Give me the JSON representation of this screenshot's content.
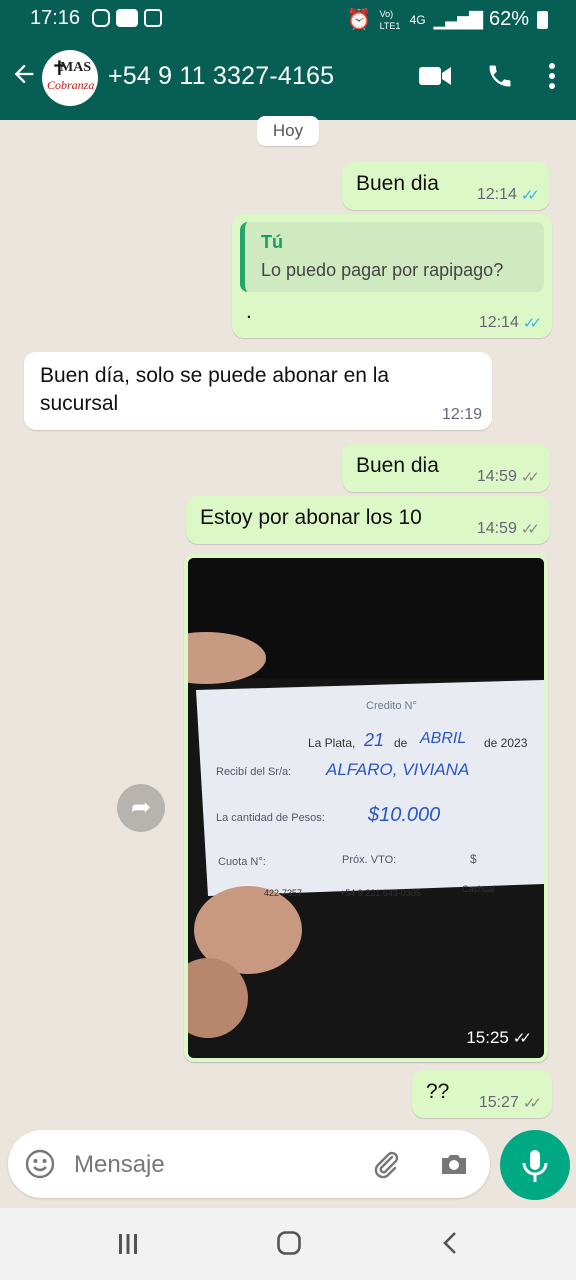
{
  "status_bar": {
    "time": "17:16",
    "network": "4G",
    "volte": "Vo) LTE1",
    "battery": "62%"
  },
  "header": {
    "contact": "+54 9 11 3327-4165",
    "avatar_text_1": "MAS",
    "avatar_text_2": "Cobranza",
    "accent_color": "#075e54"
  },
  "chat": {
    "date_chip": "Hoy",
    "messages": [
      {
        "text": "Buen dia",
        "time": "12:14",
        "direction": "out",
        "status": "read"
      },
      {
        "quote_author": "Tú",
        "quote_text": "Lo puedo pagar por rapipago?",
        "text": ".",
        "time": "12:14",
        "direction": "out",
        "status": "read"
      },
      {
        "text_line1": "Buen día, solo se puede abonar en la",
        "text_line2": "sucursal",
        "time": "12:19",
        "direction": "in"
      },
      {
        "text": "Buen dia",
        "time": "14:59",
        "direction": "out",
        "status": "sent"
      },
      {
        "text": "Estoy por abonar los 10",
        "time": "14:59",
        "direction": "out",
        "status": "sent"
      },
      {
        "type": "image",
        "time": "15:25",
        "direction": "out",
        "status": "sent",
        "receipt": {
          "credito": "Credito N°",
          "lugar": "La Plata,",
          "dia": "21",
          "de1": "de",
          "mes": "ABRIL",
          "de2": "de 2023",
          "recibi": "Recibí del Sr/a:",
          "nombre": "ALFARO, VIVIANA",
          "cantidad": "La cantidad de Pesos:",
          "monto": "$10.000",
          "cuota": "Cuota N°:",
          "prox": "Próx. VTO:",
          "signo": "$",
          "tel1": "422-7357",
          "tel2": "+54 9 221 643-0305",
          "social": "Cashual"
        }
      },
      {
        "text": "??",
        "time": "15:27",
        "direction": "out",
        "status": "sent"
      }
    ]
  },
  "input": {
    "placeholder": "Mensaje"
  },
  "colors": {
    "outgoing_bubble": "#dcf8c6",
    "incoming_bubble": "#ffffff",
    "read_ticks": "#34b7f1",
    "mic_button": "#00a884"
  }
}
